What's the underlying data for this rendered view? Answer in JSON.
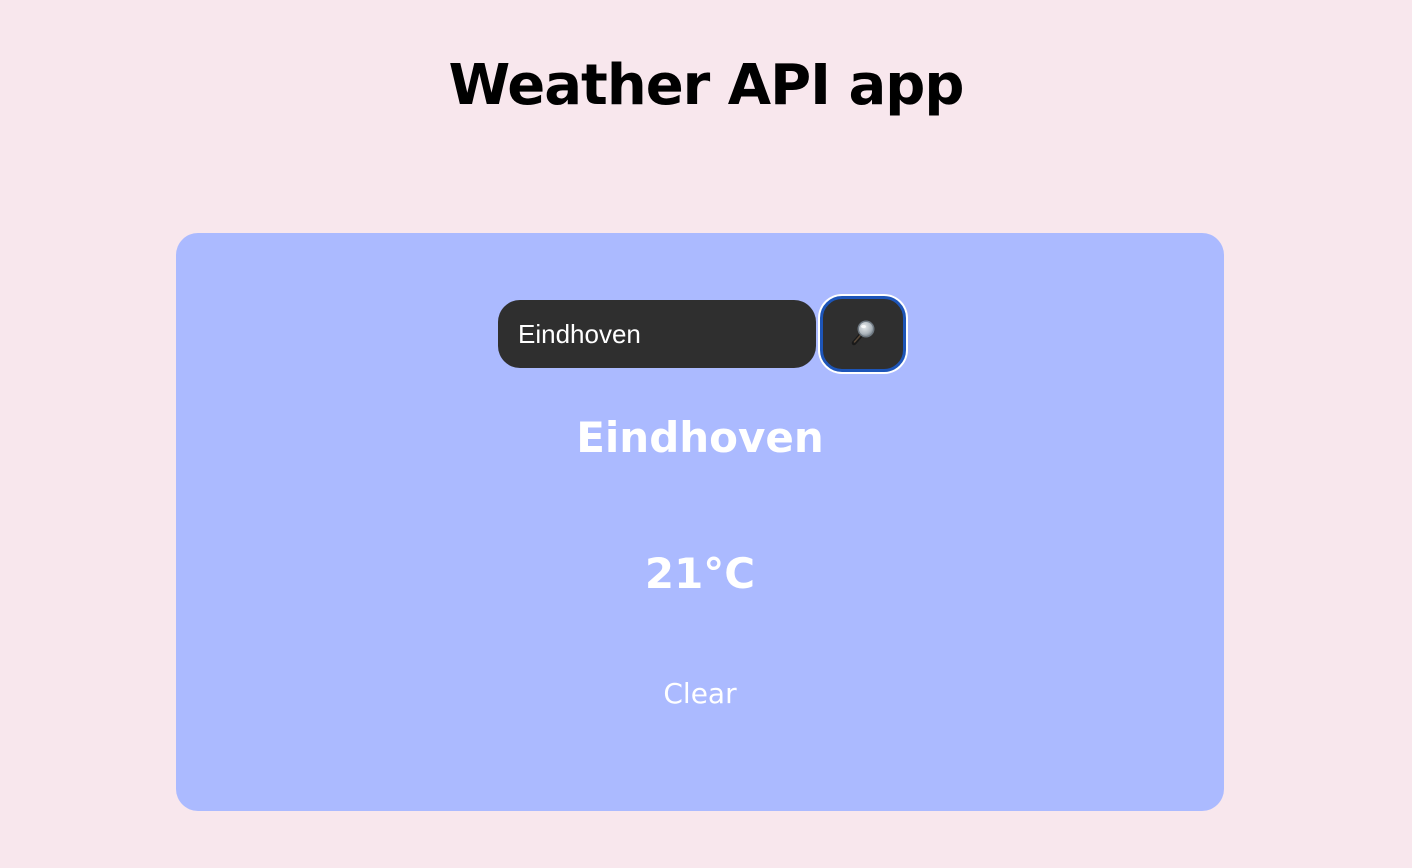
{
  "header": {
    "title": "Weather API app"
  },
  "search": {
    "value": "Eindhoven",
    "button_icon": "magnifying-glass-icon"
  },
  "weather": {
    "city": "Eindhoven",
    "temperature": "21°C",
    "condition": "Clear"
  },
  "colors": {
    "page_background": "#f8e7ed",
    "card_background": "#abbaff",
    "input_background": "#2f2f2f",
    "button_focus_ring": "#1d55b8",
    "text_on_card": "#ffffff",
    "title_text": "#000000"
  }
}
